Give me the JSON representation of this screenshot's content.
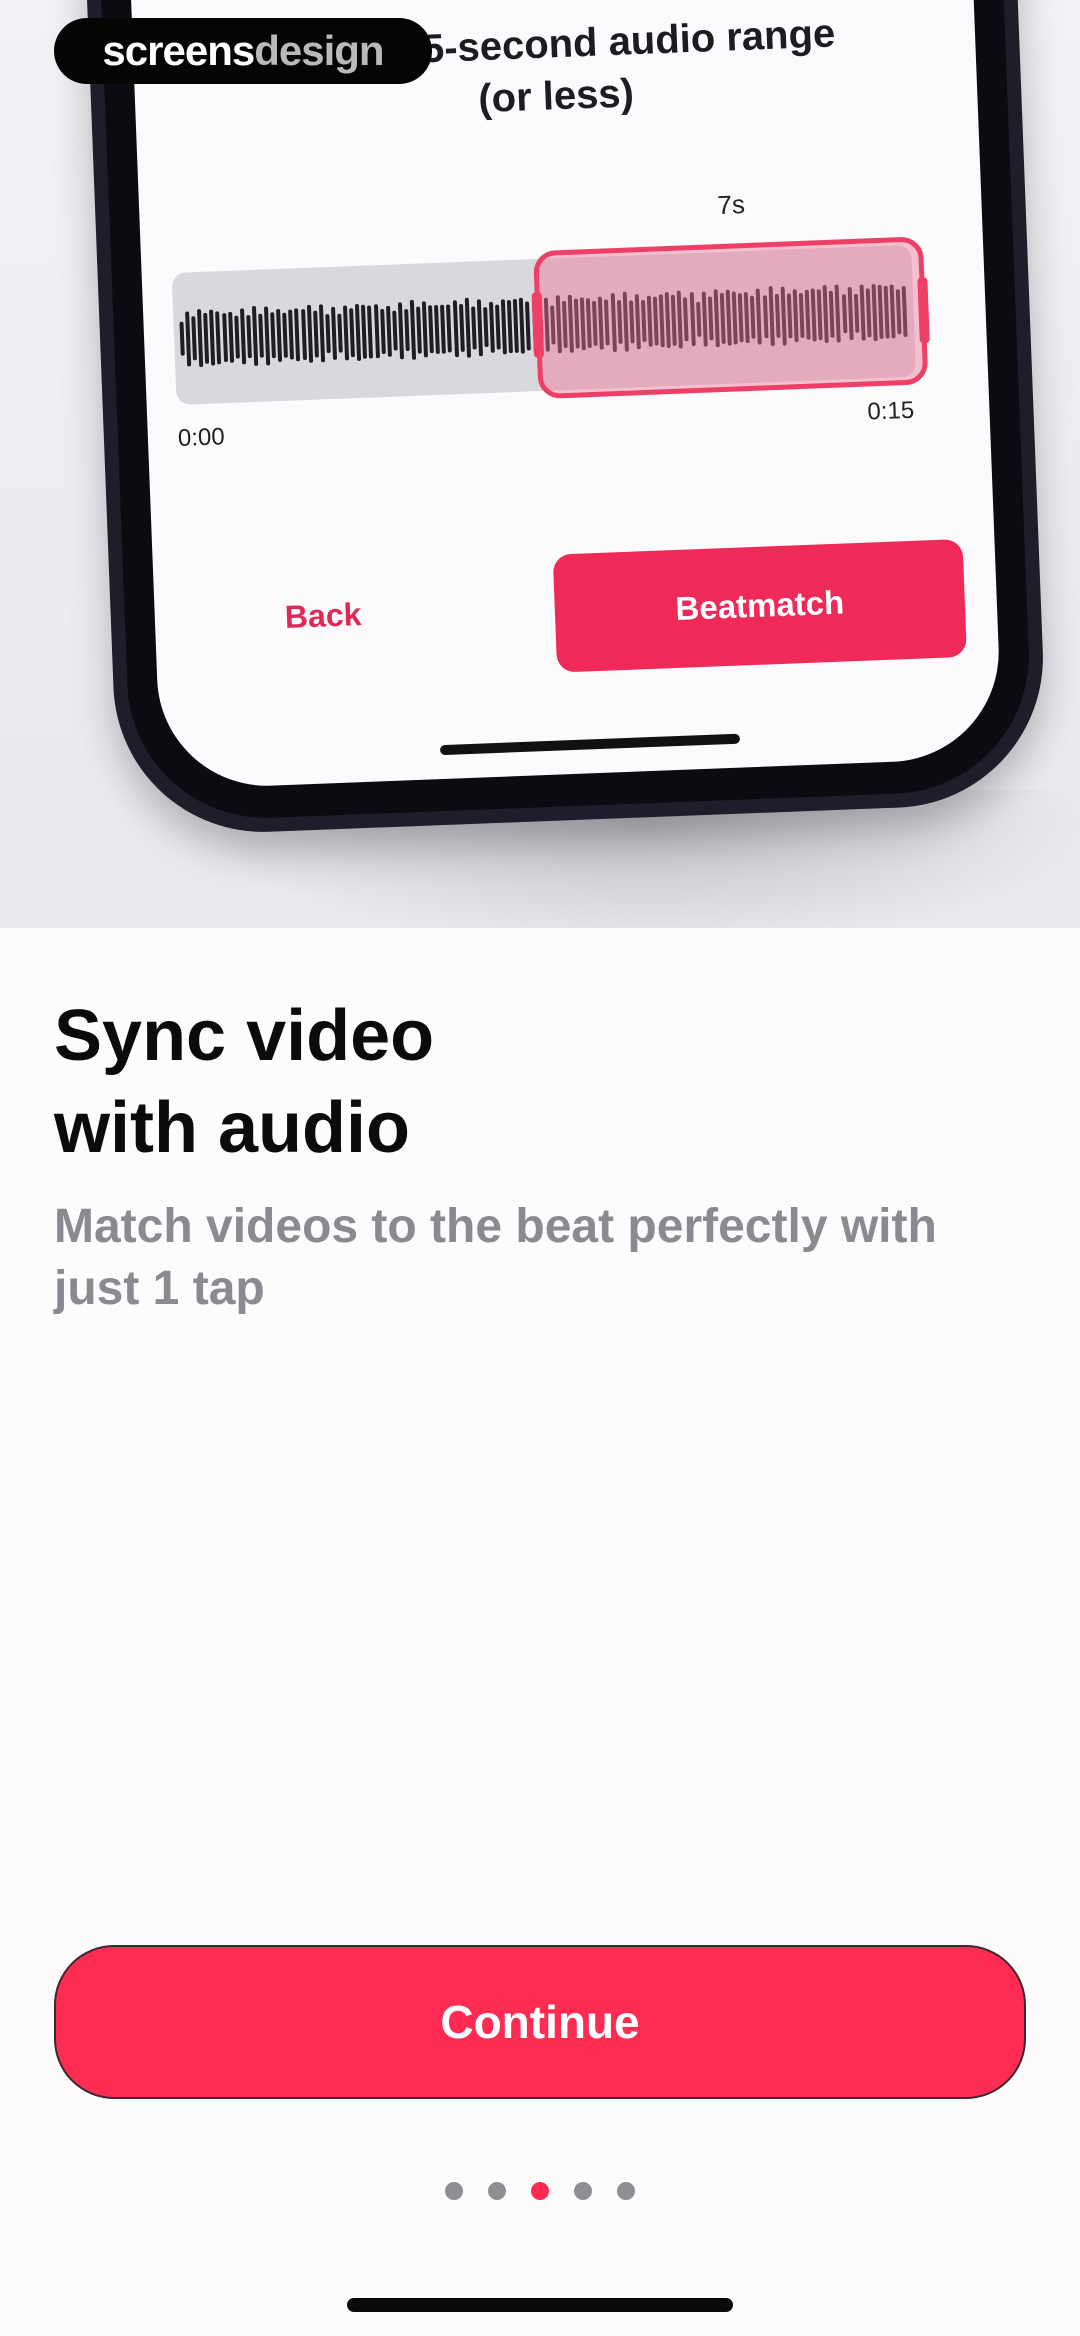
{
  "watermark": {
    "part1": "screens",
    "part2": "design"
  },
  "hero": {
    "screen_title": "Pick a 35-second audio range\n(or less)",
    "selection_duration": "7s",
    "time_start": "0:00",
    "time_end": "0:15",
    "back_label": "Back",
    "beatmatch_label": "Beatmatch"
  },
  "content": {
    "title": "Sync video\nwith audio",
    "subtitle": "Match videos to the beat perfectly with just 1 tap"
  },
  "continue_label": "Continue",
  "pagination": {
    "count": 5,
    "active_index": 2
  },
  "colors": {
    "accent": "#fe2b53",
    "dot_inactive": "#8e8e93",
    "title": "#0b0b0b",
    "subtitle": "#8a8a90"
  }
}
